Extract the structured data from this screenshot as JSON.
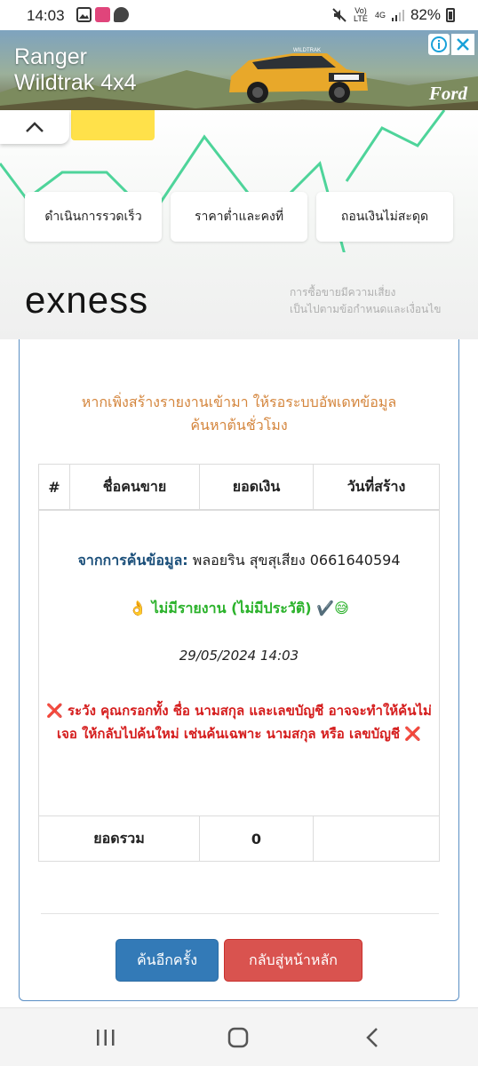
{
  "status_bar": {
    "time": "14:03",
    "volte_label": "Vo) LTE",
    "network_label": "4G",
    "battery_percent": "82%"
  },
  "ad_banner": {
    "title_line1": "Ranger",
    "title_line2": "Wildtrak 4x4",
    "brand": "Ford",
    "plate": "WILDTRAK"
  },
  "exness_ad": {
    "features": [
      "ดำเนินการรวดเร็ว",
      "ราคาต่ำและคงที่",
      "ถอนเงินไม่สะดุด"
    ],
    "logo": "exness",
    "disclaimer_line1": "การซื้อขายมีความเสี่ยง",
    "disclaimer_line2": "เป็นไปตามข้อกำหนดและเงื่อนไข"
  },
  "notice": {
    "line1": "หากเพิ่งสร้างรายงานเข้ามา ให้รอระบบอัพเดทข้อมูล",
    "line2": "ค้นหาต้นชั่วโมง"
  },
  "table": {
    "headers": [
      "#",
      "ชื่อคนขาย",
      "ยอดเงิน",
      "วันที่สร้าง"
    ],
    "search_label": "จากการค้นข้อมูล:",
    "search_value": "พลอยริน สุขสุเสียง 0661640594",
    "result_emoji": "👌",
    "result_text": "ไม่มีรายงาน (ไม่มีประวัติ)",
    "result_suffix": "✔️😅",
    "date": "29/05/2024 14:03",
    "warning_mark": "❌",
    "warning_text": "ระวัง คุณกรอกทั้ง ชื่อ นามสกุล และเลขบัญชี อาจจะทำให้ค้นไม่เจอ ให้กลับไปค้นใหม่ เช่นค้นเฉพาะ นามสกุล หรือ เลขบัญชี",
    "total_label": "ยอดรวม",
    "total_value": "0"
  },
  "buttons": {
    "search_again": "ค้นอีกครั้ง",
    "back_home": "กลับสู่หน้าหลัก"
  },
  "colors": {
    "notice": "#d4853c",
    "search_label": "#1b4f7a",
    "result": "#2bb22b",
    "warning": "#d51d1d",
    "primary_button": "#337ab7",
    "danger_button": "#d9534f",
    "card_border": "#5b8fc4"
  },
  "icons": {
    "status_left": [
      "image-icon",
      "app-icon",
      "chat-icon"
    ],
    "status_right": [
      "mute-icon",
      "signal-icon",
      "battery-icon"
    ],
    "nav": [
      "recent-apps-icon",
      "home-icon",
      "back-icon"
    ]
  }
}
